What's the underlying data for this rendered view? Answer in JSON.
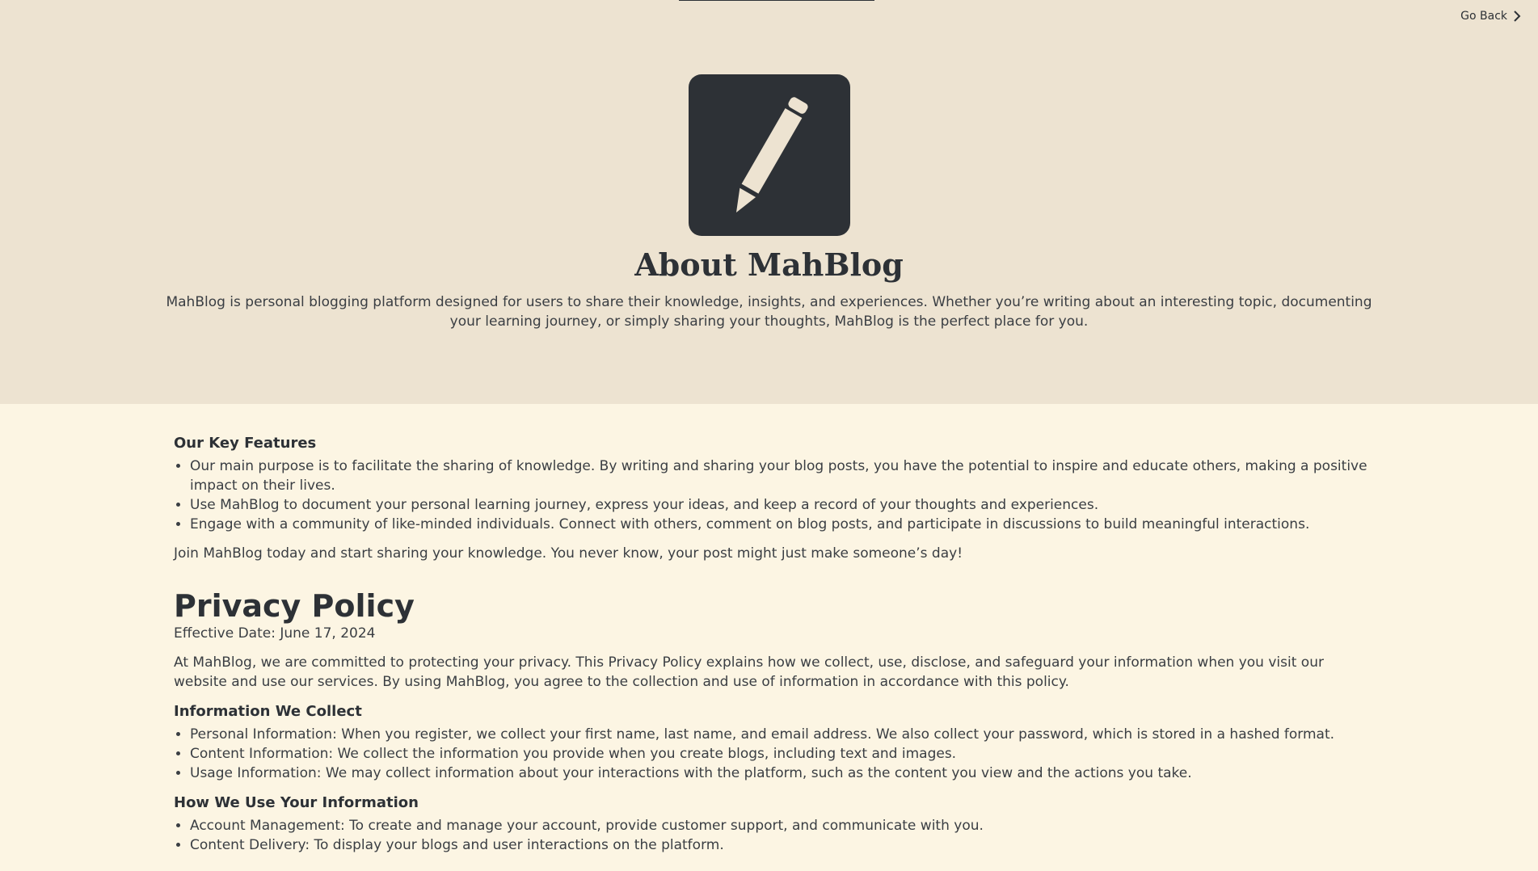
{
  "nav": {
    "go_back": "Go Back"
  },
  "hero": {
    "logo_icon": "pencil-icon",
    "title": "About MahBlog",
    "description": "MahBlog is personal blogging platform designed for users to share their knowledge, insights, and experiences. Whether you’re writing about an interesting topic, documenting your learning journey, or simply sharing your thoughts, MahBlog is the perfect place for you."
  },
  "features": {
    "heading": "Our Key Features",
    "items": [
      "Our main purpose is to facilitate the sharing of knowledge. By writing and sharing your blog posts, you have the potential to inspire and educate others, making a positive impact on their lives.",
      "Use MahBlog to document your personal learning journey, express your ideas, and keep a record of your thoughts and experiences.",
      "Engage with a community of like-minded individuals. Connect with others, comment on blog posts, and participate in discussions to build meaningful interactions."
    ],
    "closing": "Join MahBlog today and start sharing your knowledge. You never know, your post might just make someone’s day!"
  },
  "privacy": {
    "title": "Privacy Policy",
    "effective_date": "Effective Date: June 17, 2024",
    "intro": "At MahBlog, we are committed to protecting your privacy. This Privacy Policy explains how we collect, use, disclose, and safeguard your information when you visit our website and use our services. By using MahBlog, you agree to the collection and use of information in accordance with this policy.",
    "collect_heading": "Information We Collect",
    "collect_items": [
      "Personal Information: When you register, we collect your first name, last name, and email address. We also collect your password, which is stored in a hashed format.",
      "Content Information: We collect the information you provide when you create blogs, including text and images.",
      "Usage Information: We may collect information about your interactions with the platform, such as the content you view and the actions you take."
    ],
    "use_heading": "How We Use Your Information",
    "use_items": [
      "Account Management: To create and manage your account, provide customer support, and communicate with you.",
      "Content Delivery: To display your blogs and user interactions on the platform."
    ]
  },
  "colors": {
    "hero_bg": "#ede3d1",
    "content_bg": "#fcf5e3",
    "dark": "#2d3136"
  }
}
